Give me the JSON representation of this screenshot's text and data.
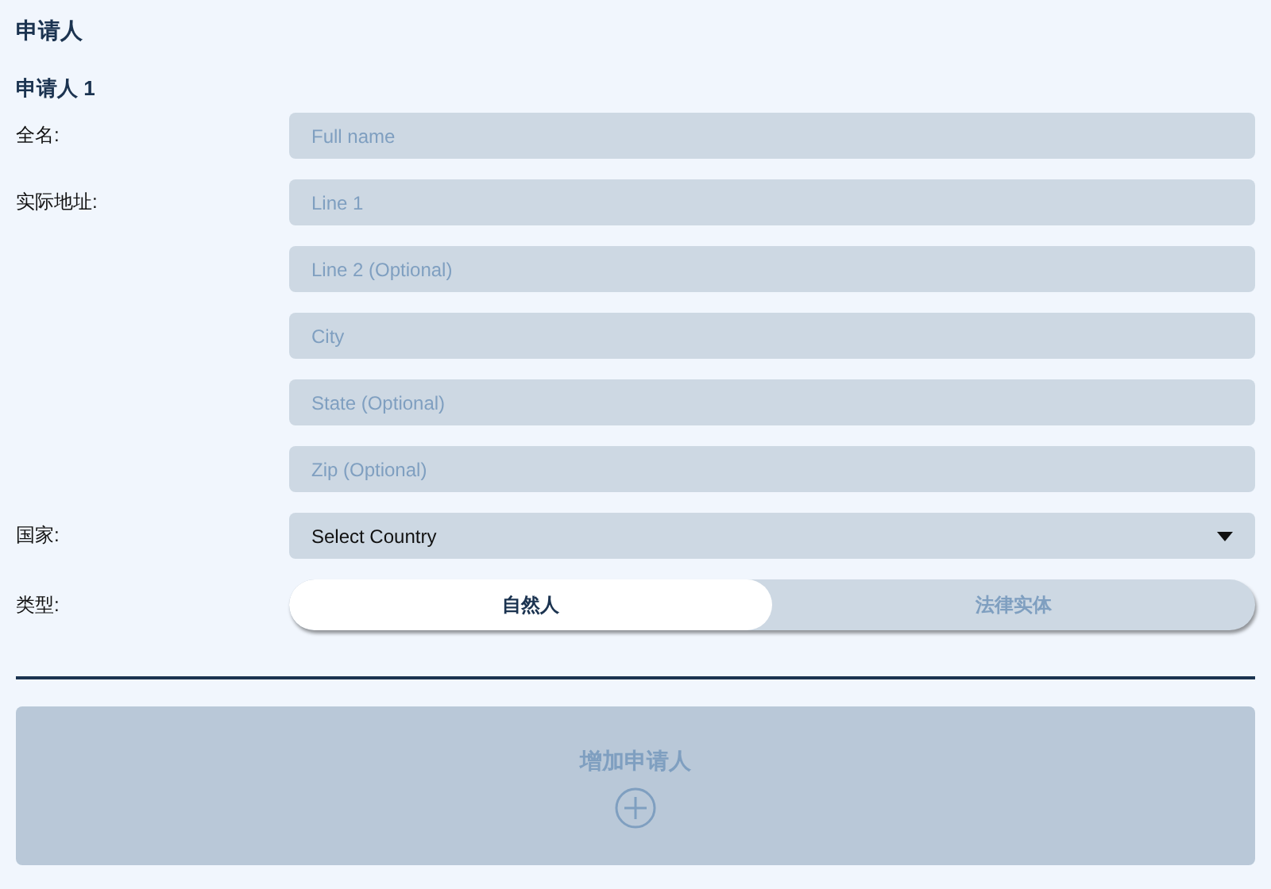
{
  "title": "申请人",
  "applicant_heading": "申请人 1",
  "full_name": {
    "label": "全名:",
    "placeholder": "Full name"
  },
  "address": {
    "label": "实际地址:",
    "placeholders": [
      "Line 1",
      "Line 2 (Optional)",
      "City",
      "State (Optional)",
      "Zip (Optional)"
    ]
  },
  "country": {
    "label": "国家:",
    "value": "Select Country"
  },
  "type": {
    "label": "类型:",
    "options": [
      {
        "label": "自然人",
        "selected": true
      },
      {
        "label": "法律实体",
        "selected": false
      }
    ]
  },
  "add_button": {
    "label": "增加申请人"
  }
}
